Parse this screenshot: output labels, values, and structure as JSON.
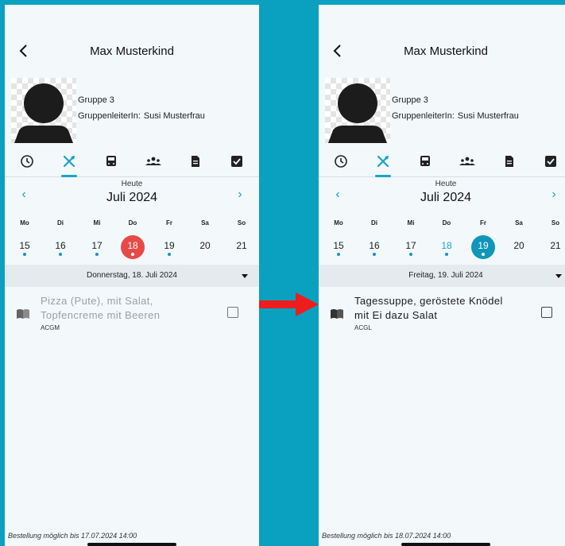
{
  "colors": {
    "background": "#0aa0c0",
    "accent": "#1aa3c8",
    "selected_red": "#e84a47",
    "selected_teal": "#0f96b8",
    "arrow": "#ee1c1c"
  },
  "weekdays": [
    "Mo",
    "Di",
    "Mi",
    "Do",
    "Fr",
    "Sa",
    "So"
  ],
  "tab_icons": [
    "clock-icon",
    "fork-knife-icon",
    "bus-icon",
    "group-icon",
    "document-icon",
    "checkbox-icon"
  ],
  "left": {
    "title": "Max Musterkind",
    "group": "Gruppe 3",
    "leader_label": "GruppenleiterIn:",
    "leader_name": "Susi Musterfrau",
    "today_label": "Heute",
    "month": "Juli 2024",
    "days": [
      "15",
      "16",
      "17",
      "18",
      "19",
      "20",
      "21"
    ],
    "selected_day": "18",
    "date_bar": "Donnerstag, 18. Juli 2024",
    "meal": {
      "text": "Pizza (Pute), mit Salat, Topfencreme mit Beeren",
      "code": "ACGM",
      "checked": false
    },
    "footer": "Bestellung möglich bis 17.07.2024 14:00"
  },
  "right": {
    "title": "Max Musterkind",
    "group": "Gruppe 3",
    "leader_label": "GruppenleiterIn:",
    "leader_name": "Susi Musterfrau",
    "today_label": "Heute",
    "month": "Juli 2024",
    "days": [
      "15",
      "16",
      "17",
      "18",
      "19",
      "20",
      "21"
    ],
    "selected_day": "19",
    "date_bar": "Freitag, 19. Juli 2024",
    "meal": {
      "text": "Tagessuppe, geröstete Knödel mit Ei dazu Salat",
      "code": "ACGL",
      "checked": false
    },
    "footer": "Bestellung möglich bis 18.07.2024 14:00"
  }
}
